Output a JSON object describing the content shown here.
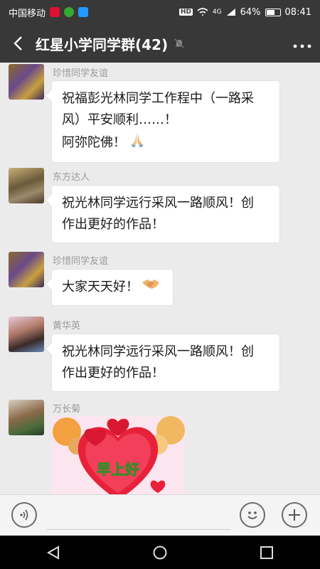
{
  "status_bar": {
    "carrier": "中国移动",
    "hd": "HD",
    "signal": "4G",
    "battery": "64%",
    "battery_level": 0.64,
    "time": "08:41"
  },
  "header": {
    "title": "红星小学同学群(42)",
    "icons": [
      "back-arrow-icon",
      "mute-bell-icon",
      "more-dots-icon"
    ]
  },
  "messages": [
    {
      "sender": "珍惜同学友谊",
      "lines": [
        "祝福彭光林同学工作程中（一路采",
        "风）平安顺利……！",
        "阿弥陀佛！"
      ],
      "emoji": "praying-hands"
    },
    {
      "sender": "东方达人",
      "lines": [
        "祝光林同学远行采风一路顺风！创",
        "作出更好的作品！"
      ]
    },
    {
      "sender": "珍惜同学友谊",
      "lines": [
        "大家天天好！"
      ],
      "emoji": "handshake"
    },
    {
      "sender": "黄华英",
      "lines": [
        "祝光林同学远行采风一路顺风！创",
        "作出更好的作品！"
      ]
    },
    {
      "sender": "万长菊",
      "image_text": "早上好"
    }
  ],
  "input_bar": {
    "voice_icon": "voice-icon",
    "emoji_icon": "emoji-icon",
    "add_icon": "add-icon"
  },
  "colors": {
    "header_bg": "#383838",
    "chat_bg": "#ebebeb",
    "bubble_bg": "#ffffff"
  }
}
